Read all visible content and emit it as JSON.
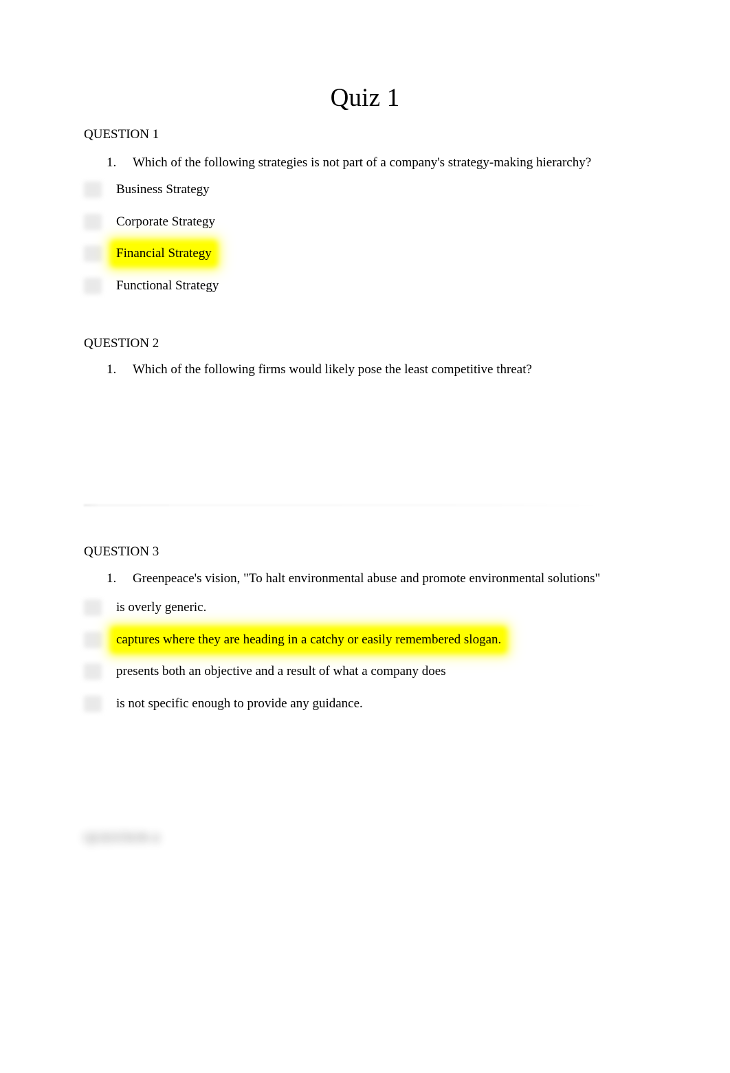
{
  "document": {
    "title": "Quiz 1"
  },
  "questions": [
    {
      "heading": "QUESTION 1",
      "number": "1.",
      "stem": "Which of the following strategies is not part of a company's strategy-making hierarchy?",
      "options": [
        {
          "text": "Business Strategy",
          "highlighted": false
        },
        {
          "text": "Corporate Strategy",
          "highlighted": false
        },
        {
          "text": "Financial Strategy",
          "highlighted": true
        },
        {
          "text": "Functional Strategy",
          "highlighted": false
        }
      ]
    },
    {
      "heading": "QUESTION 2",
      "number": "1.",
      "stem": "Which of the following firms would likely pose the least competitive threat?",
      "options": []
    },
    {
      "heading": "QUESTION 3",
      "number": "1.",
      "stem": "Greenpeace's vision, \"To halt environmental abuse and promote environmental solutions\"",
      "options": [
        {
          "text": "is overly generic.",
          "highlighted": false
        },
        {
          "text": "captures where they are heading in a catchy or easily remembered slogan.",
          "highlighted": true
        },
        {
          "text": "presents both an objective and a result of what a company does",
          "highlighted": false
        },
        {
          "text": "is not specific enough to provide any guidance.",
          "highlighted": false
        }
      ]
    }
  ],
  "redacted_heading": {
    "text": "QUESTION 4"
  },
  "colors": {
    "highlight": "#ffff00",
    "text": "#000000",
    "page_background": "#ffffff",
    "radio": "#d8d8d8",
    "divider": "#e8e8e8"
  }
}
